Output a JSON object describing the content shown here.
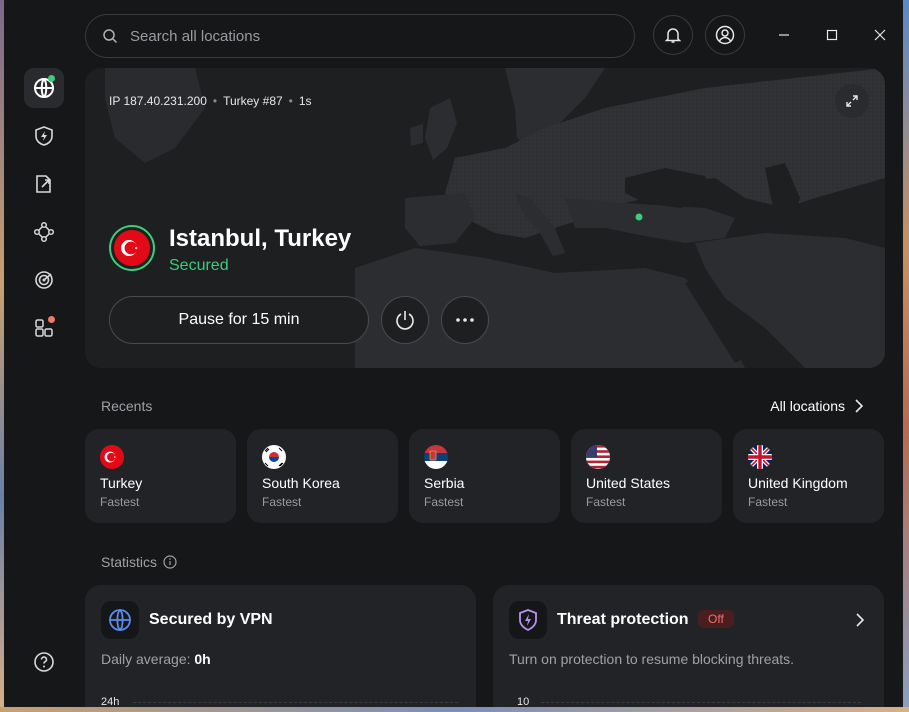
{
  "search": {
    "placeholder": "Search all locations"
  },
  "connection": {
    "ip": "IP 187.40.231.200",
    "server": "Turkey #87",
    "duration": "1s",
    "location": "Istanbul, Turkey",
    "status": "Secured",
    "pause_label": "Pause for 15 min"
  },
  "recents": {
    "label": "Recents",
    "all_label": "All locations",
    "items": [
      {
        "name": "Turkey",
        "sub": "Fastest"
      },
      {
        "name": "South Korea",
        "sub": "Fastest"
      },
      {
        "name": "Serbia",
        "sub": "Fastest"
      },
      {
        "name": "United States",
        "sub": "Fastest"
      },
      {
        "name": "United Kingdom",
        "sub": "Fastest"
      }
    ]
  },
  "statistics": {
    "label": "Statistics",
    "vpn": {
      "title": "Secured by VPN",
      "daily_label": "Daily average: ",
      "daily_value": "0h",
      "axis_top": "24h"
    },
    "threat": {
      "title": "Threat protection",
      "badge": "Off",
      "message": "Turn on protection to resume blocking threats.",
      "axis_top": "10"
    }
  },
  "colors": {
    "accent_green": "#3ccc7a",
    "background": "#161718",
    "card": "#222326",
    "off_red": "#f07070"
  },
  "icons": [
    "globe-icon",
    "shield-bolt-icon",
    "split-tunnel-icon",
    "meshnet-icon",
    "dark-web-monitor-icon",
    "apps-icon",
    "help-icon",
    "bell-icon",
    "account-icon",
    "search-icon",
    "expand-icon",
    "power-icon",
    "more-icon",
    "chevron-right-icon",
    "info-icon"
  ]
}
